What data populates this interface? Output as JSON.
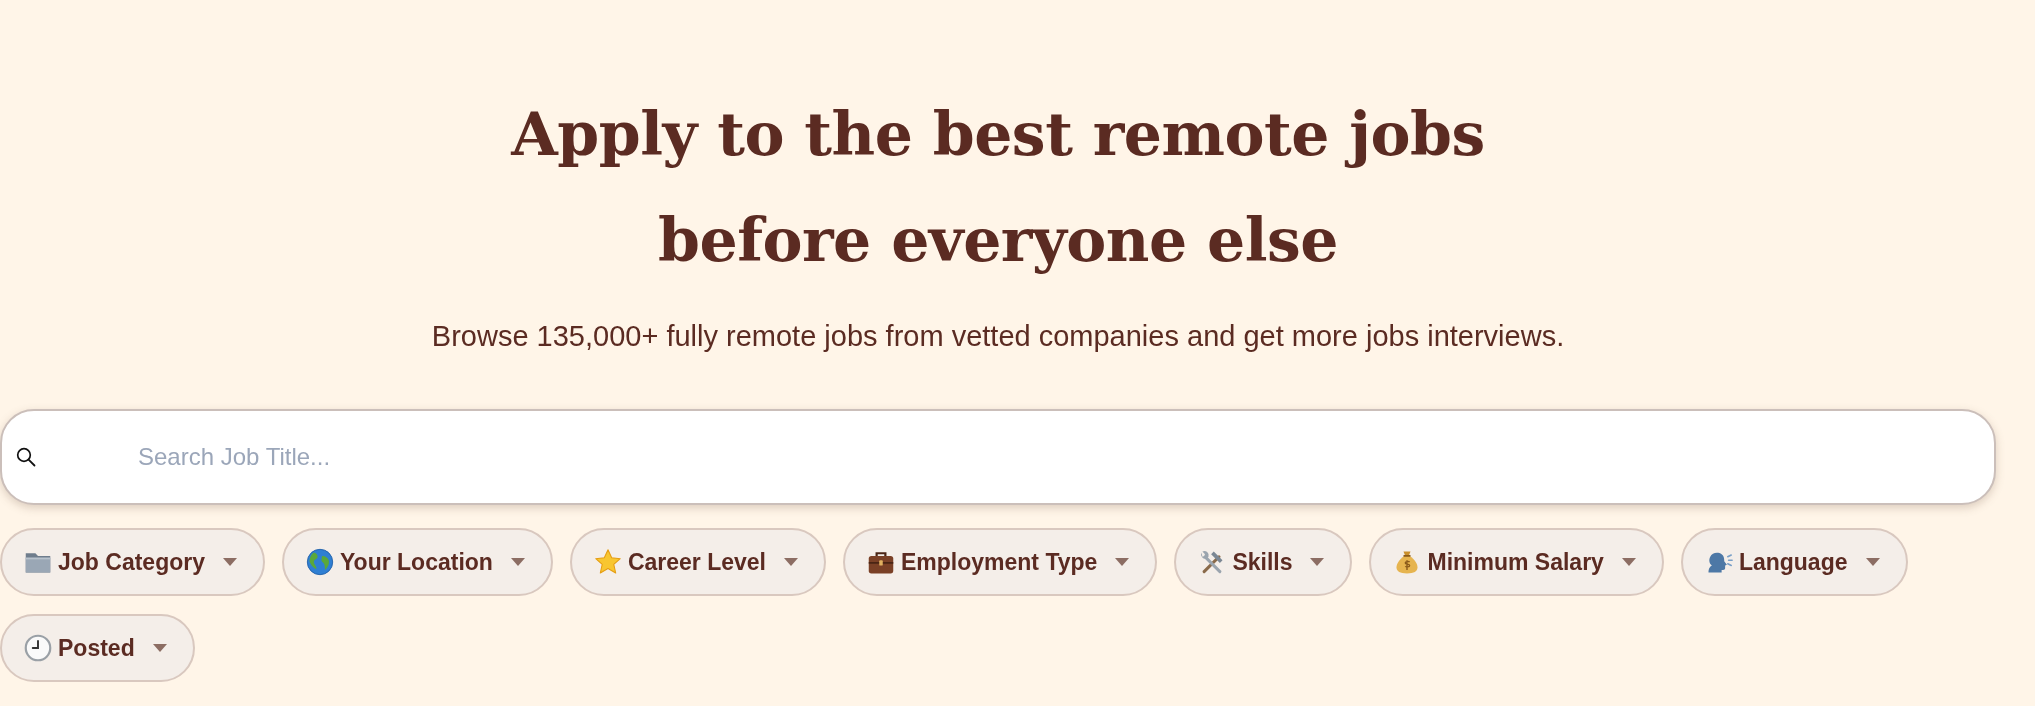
{
  "hero": {
    "title": "Apply to the best remote jobs before everyone else",
    "subtitle": "Browse 135,000+ fully remote jobs from vetted companies and get more jobs interviews."
  },
  "search": {
    "placeholder": "Search Job Title..."
  },
  "filters": [
    {
      "kind": "category",
      "label": "Job Category"
    },
    {
      "kind": "location",
      "label": "Your Location"
    },
    {
      "kind": "level",
      "label": "Career Level"
    },
    {
      "kind": "employment",
      "label": "Employment Type"
    },
    {
      "kind": "skills",
      "label": "Skills"
    },
    {
      "kind": "salary",
      "label": "Minimum Salary"
    },
    {
      "kind": "language",
      "label": "Language"
    },
    {
      "kind": "posted",
      "label": "Posted"
    }
  ]
}
